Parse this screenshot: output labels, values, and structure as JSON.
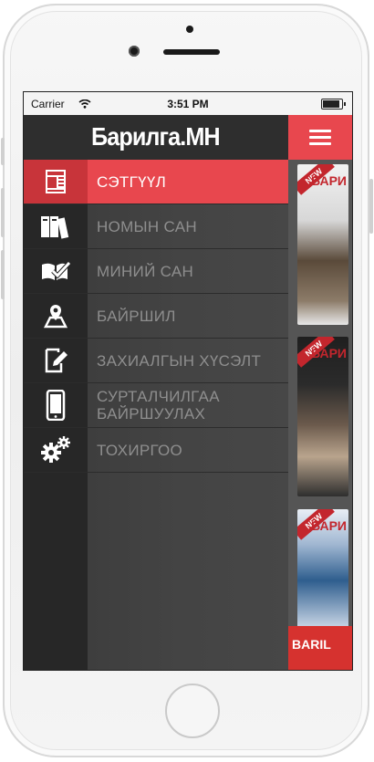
{
  "status_bar": {
    "carrier": "Carrier",
    "time": "3:51 PM"
  },
  "header": {
    "logo_text": "Барилга.МН"
  },
  "menu": {
    "items": [
      {
        "label": "СЭТГҮҮЛ",
        "icon": "magazine-icon",
        "active": true
      },
      {
        "label": "НОМЫН САН",
        "icon": "books-icon",
        "active": false
      },
      {
        "label": "МИНИЙ САН",
        "icon": "open-book-check-icon",
        "active": false
      },
      {
        "label": "БАЙРШИЛ",
        "icon": "map-pin-icon",
        "active": false
      },
      {
        "label": "ЗАХИАЛГЫН ХҮСЭЛТ",
        "icon": "edit-document-icon",
        "active": false
      },
      {
        "label": "СУРТАЛЧИЛГАА БАЙРШУУЛАХ",
        "icon": "mobile-phone-icon",
        "active": false
      },
      {
        "label": "ТОХИРГОО",
        "icon": "gears-icon",
        "active": false
      }
    ]
  },
  "right_panel": {
    "hamburger_icon": "hamburger-menu-icon",
    "magazines": [
      {
        "badge": "NEW",
        "title": "БАРИ"
      },
      {
        "badge": "NEW",
        "title": "БАРИ"
      },
      {
        "badge": "NEW",
        "title": "БАРИ"
      }
    ],
    "banner_text": "BARIL"
  },
  "colors": {
    "accent": "#e8474e",
    "menu_bg": "#404040",
    "icon_column_bg": "#272727",
    "label_inactive": "#8e8e8e"
  }
}
